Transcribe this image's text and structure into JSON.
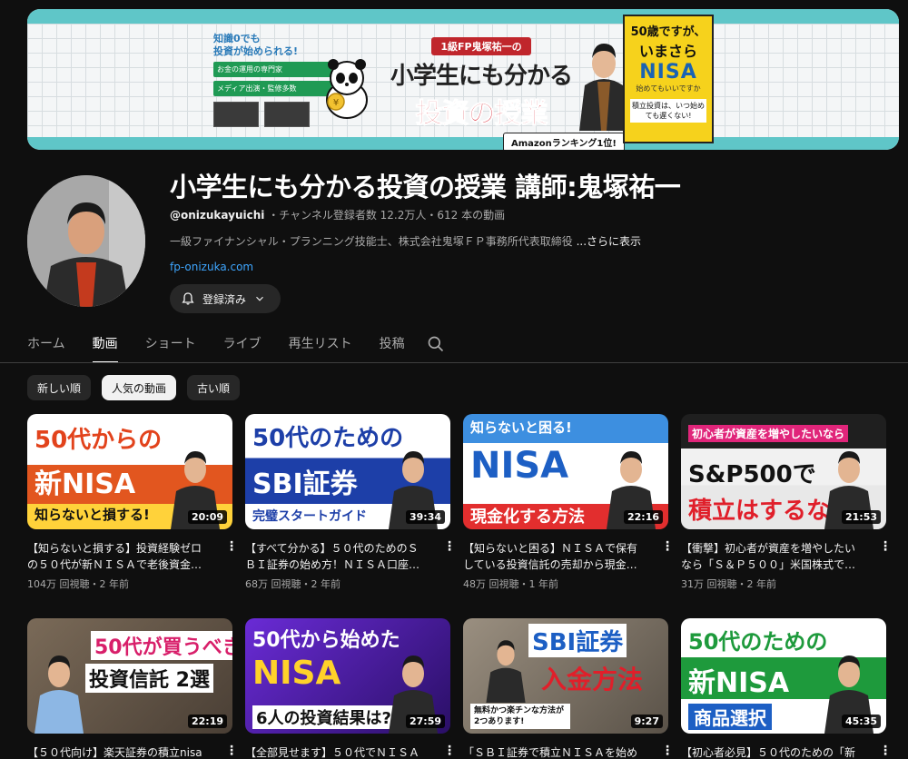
{
  "banner": {
    "knowledge_line1": "知識0でも",
    "knowledge_line2": "投資が始められる!",
    "chip1": "お金の運用の専門家",
    "chip2": "メディア出演・監修多数",
    "fp_label": "1級FP鬼塚祐一の",
    "headline1": "小学生にも分かる",
    "headline2": "投資の授業",
    "amazon_badge": "Amazonランキング1位!",
    "book_line1": "50歳ですが、",
    "book_line2": "いまさら",
    "book_line3": "NISA",
    "book_line4": "始めてもいいですか",
    "book_line5": "積立投資は、いつ始めても遅くない!"
  },
  "channel": {
    "title": "小学生にも分かる投資の授業 講師:鬼塚祐一",
    "handle": "@onizukayuichi",
    "meta": " ・チャンネル登録者数 12.2万人・612 本の動画",
    "description": "一級ファイナンシャル・プランニング技能士、株式会社鬼塚ＦＰ事務所代表取締役",
    "more": "...さらに表示",
    "link": "fp-onizuka.com",
    "subscribe_label": "登録済み"
  },
  "tabs": [
    {
      "label": "ホーム"
    },
    {
      "label": "動画"
    },
    {
      "label": "ショート"
    },
    {
      "label": "ライブ"
    },
    {
      "label": "再生リスト"
    },
    {
      "label": "投稿"
    }
  ],
  "active_tab": "動画",
  "chips": [
    {
      "label": "新しい順"
    },
    {
      "label": "人気の動画"
    },
    {
      "label": "古い順"
    }
  ],
  "videos": [
    {
      "thumb_l1": "50代からの",
      "thumb_l2": "新NISA",
      "thumb_l3": "知らないと損する!",
      "duration": "20:09",
      "title": "【知らないと損する】投資経験ゼロの５０代が新ＮＩＳＡで老後資金…",
      "stats": "104万 回視聴・2 年前"
    },
    {
      "thumb_l1": "50代のための",
      "thumb_l2": "SBI証券",
      "thumb_l3": "完璧スタートガイド",
      "duration": "39:34",
      "title": "【すべて分かる】５０代のためのＳＢＩ証券の始め方！ＮＩＳＡ口座…",
      "stats": "68万 回視聴・2 年前"
    },
    {
      "thumb_l1": "知らないと困る!",
      "thumb_l2": "NISA",
      "thumb_l3": "現金化する方法",
      "duration": "22:16",
      "title": "【知らないと困る】ＮＩＳＡで保有している投資信託の売却から現金…",
      "stats": "48万 回視聴・1 年前"
    },
    {
      "thumb_l1": "初心者が資産を増やしたいなら",
      "thumb_l2": "S&P500で",
      "thumb_l3": "積立はするな!",
      "duration": "21:53",
      "title": "【衝撃】初心者が資産を増やしたいなら「Ｓ＆Ｐ５００」米国株式で…",
      "stats": "31万 回視聴・2 年前"
    },
    {
      "thumb_l1": "50代が買うべき",
      "thumb_l2": "投資信託 2選",
      "thumb_l3": "",
      "duration": "22:19",
      "title": "【５０代向け】楽天証券の積立nisa",
      "stats": ""
    },
    {
      "thumb_l1": "50代から始めた",
      "thumb_l2": "NISA",
      "thumb_l3": "6人の投資結果は?",
      "duration": "27:59",
      "title": "【全部見せます】５０代でＮＩＳＡ",
      "stats": ""
    },
    {
      "thumb_l1": "SBI証券",
      "thumb_l2": "入金方法",
      "thumb_l3": "無料かつ楽チンな方法が2つあります!",
      "duration": "9:27",
      "title": "「ＳＢＩ証券で積立ＮＩＳＡを始め",
      "stats": ""
    },
    {
      "thumb_l1": "50代のための",
      "thumb_l2": "新NISA",
      "thumb_l3": "商品選択",
      "duration": "45:35",
      "title": "【初心者必見】５０代のための「新",
      "stats": ""
    }
  ]
}
